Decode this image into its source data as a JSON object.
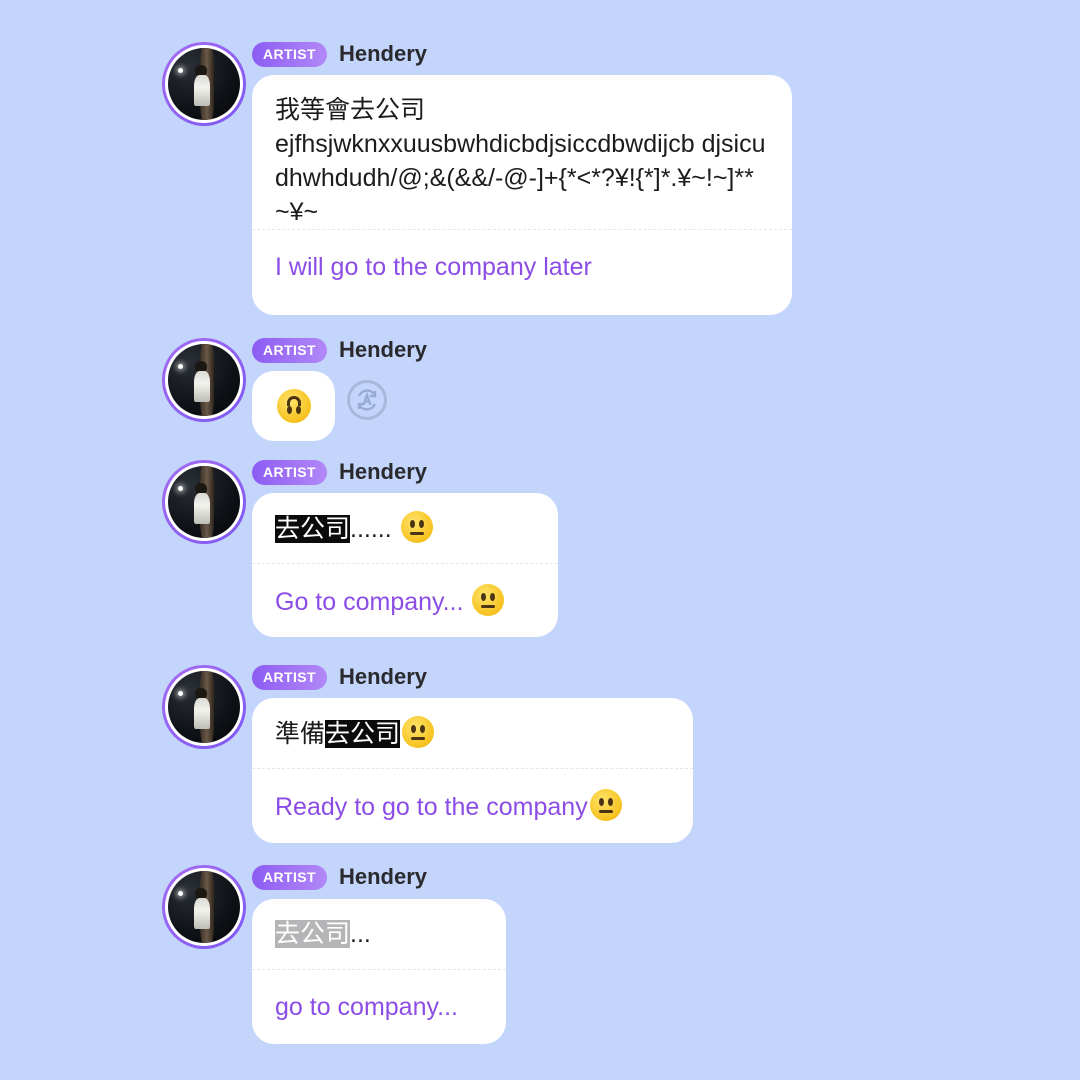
{
  "messages": [
    {
      "badge": "ARTIST",
      "sender": "Hendery",
      "original_line1": "我等會去公司",
      "original_line2": "ejfhsjwknxxuusbwhdicbdjsiccdbwdijcb djsicudhwhdudh/@;&(&&/-@-]+{*<*?¥!{*]*.¥~!~]**~¥~",
      "translation": "I will go to the company later"
    },
    {
      "badge": "ARTIST",
      "sender": "Hendery",
      "emoji": "upside-down-face",
      "translate_icon": "translate-icon"
    },
    {
      "badge": "ARTIST",
      "sender": "Hendery",
      "original_highlight": "去公司",
      "original_rest": "......",
      "translation": "Go to company... "
    },
    {
      "badge": "ARTIST",
      "sender": "Hendery",
      "original_prefix": "準備",
      "original_highlight": "去公司",
      "translation": "Ready to go to the company"
    },
    {
      "badge": "ARTIST",
      "sender": "Hendery",
      "original_highlight": "去公司",
      "original_rest": "...",
      "translation": "go to company..."
    }
  ],
  "colors": {
    "background": "#c3d5fb",
    "badge": "#8d5cf3",
    "translation_text": "#8b4de6",
    "bubble": "#ffffff"
  }
}
